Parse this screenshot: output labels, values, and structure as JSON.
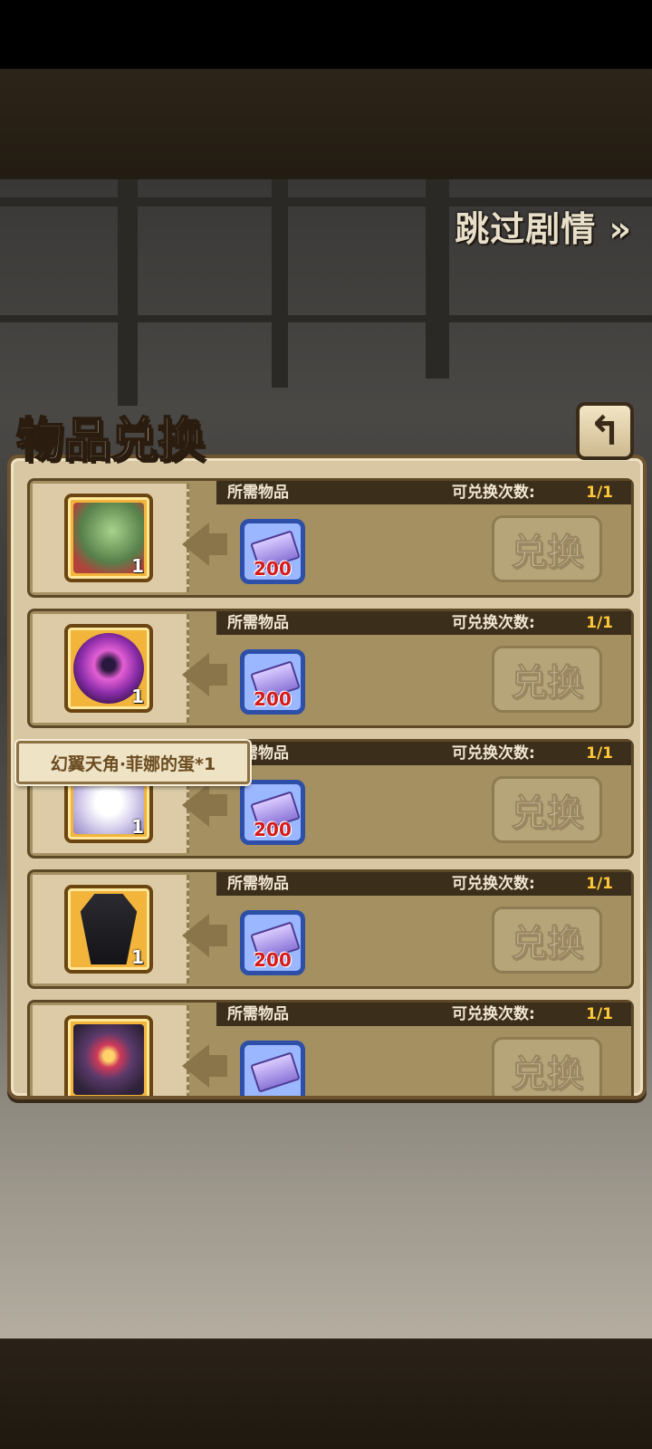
{
  "header": {
    "skip_label": "跳过剧情 »"
  },
  "panel": {
    "title": "物品兑换",
    "back_icon": "back-arrow-icon"
  },
  "exchange_rows": [
    {
      "required_label": "所需物品",
      "count_label": "可兑换次数:",
      "count_value": "1/1",
      "reward_qty": "1",
      "cost_amount": "200",
      "button_label": "兑换",
      "reward_icon": "green-egg-icon"
    },
    {
      "required_label": "所需物品",
      "count_label": "可兑换次数:",
      "count_value": "1/1",
      "reward_qty": "1",
      "cost_amount": "200",
      "button_label": "兑换",
      "reward_icon": "purple-orb-icon"
    },
    {
      "required_label": "所需物品",
      "count_label": "可兑换次数:",
      "count_value": "1/1",
      "reward_qty": "1",
      "cost_amount": "200",
      "button_label": "兑换",
      "reward_icon": "winged-egg-icon"
    },
    {
      "required_label": "所需物品",
      "count_label": "可兑换次数:",
      "count_value": "1/1",
      "reward_qty": "1",
      "cost_amount": "200",
      "button_label": "兑换",
      "reward_icon": "coffin-icon"
    },
    {
      "required_label": "所需物品",
      "count_label": "可兑换次数:",
      "count_value": "1/1",
      "reward_qty": "",
      "cost_amount": "",
      "button_label": "兑换",
      "reward_icon": "helmet-icon"
    }
  ],
  "tooltip": {
    "text": "幻翼天角·菲娜的蛋*1"
  },
  "colors": {
    "count_value": "#ffc83a",
    "cost_amount": "#d41c1c",
    "panel_bg": "#d9c7a3"
  }
}
